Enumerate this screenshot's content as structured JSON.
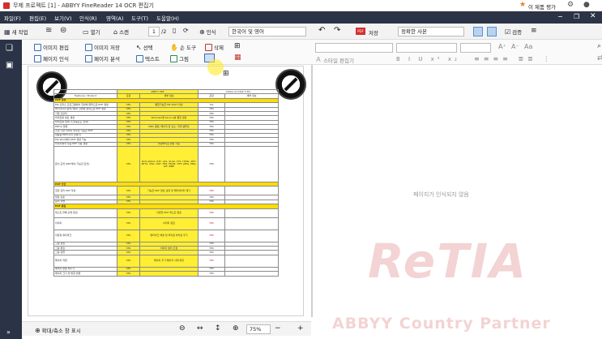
{
  "title": {
    "text": "무제 프로젝트 [1] - ABBYY FineReader 14 OCR 편집기",
    "rating": "이 제품 평가"
  },
  "menu": [
    "파일(F)",
    "편집(E)",
    "보기(V)",
    "인식(R)",
    "영역(A)",
    "도구(T)",
    "도움말(H)"
  ],
  "toolbar": {
    "new_task": "새 작업",
    "open": "열기",
    "scan": "스캔",
    "page_num": "1",
    "page_total": "/2",
    "recognize": "인식",
    "language": "한국어 및 영어",
    "save": "저장",
    "save_mode": "정확한 사본",
    "check": "검증"
  },
  "ribbon": {
    "image_edit": "이미지 편집",
    "image_save": "이미지 저장",
    "page_recog": "페이지 인식",
    "page_analyze": "페이지 분석",
    "select": "선택",
    "hand_tool": "손 도구",
    "delete": "삭제",
    "text": "텍스트",
    "picture": "그림",
    "style_editor": "스타일 편집기"
  },
  "doc": {
    "side_label": "[ [FS] 출력마마 편집 기능 비교 (FS) ]",
    "col_header": "Features / Product",
    "abbyy": "ABBYY PDF",
    "adobe": "Adobe Acrobat X Pro",
    "sub": [
      "포함",
      "세부 정보",
      "포함",
      "세부 정보"
    ],
    "rows": [
      [
        "sec",
        "PDF 생성",
        "",
        "",
        ""
      ],
      [
        "r",
        "MS 오피스 프로그램에서 한번에 클릭으로 PDF 생성",
        "YES",
        "통합가능한 MS 2007 이상",
        "Yes"
      ],
      [
        "r",
        "Windows 탐색기에서 한번에 클릭으로 PDF 생성",
        "YES",
        "",
        "YES"
      ],
      [
        "r",
        "기업 프린터",
        "YES",
        "",
        "YES"
      ],
      [
        "r",
        "바이트를 필요 생성",
        "YES",
        "Windows에 Service를 통한 생성",
        "YES"
      ],
      [
        "r",
        "바이트를 현재 기간(중요도 전략)",
        "YES",
        "",
        "YES"
      ],
      [
        "r",
        "PDF/A 압축",
        "YES",
        "MRC 종편, 페이지 정 감소, 기대 템플릿",
        "YES"
      ],
      [
        "r",
        "스캔 기반 이미지 최우선 가능한 PDF",
        "YES",
        "",
        "YES"
      ],
      [
        "r",
        "대용량 PDF(자서 인쇄기)",
        "YES",
        "",
        "YES"
      ],
      [
        "r",
        "MS Word에서 PDF 생성 가능",
        "YES",
        "",
        "YES"
      ],
      [
        "r",
        "이미지에서 다중 PDF 자동 생성",
        "YES",
        "불량처리로 변환 가능",
        "YES"
      ],
      [
        "t",
        "문서 포맷 (PDF에서 가능한 포맷)",
        "YES",
        "DOC,DOCX, RTF, XLS, XLSX, TXT, HTML, PPT, PPTX, XML, ODT, FB2, EPUB, TIFF, JPEG, PNG, GIF, BMP",
        "YES"
      ],
      [
        "sec",
        "PDF 보안",
        "",
        "",
        ""
      ],
      [
        "r2",
        "권한 관리 PDF 작성",
        "YES",
        "가능한 PDF 암호 설정 및 메타데이터 제거",
        "YES"
      ],
      [
        "r",
        "암호 보호",
        "YES",
        "",
        "YES"
      ],
      [
        "r",
        "문서 서명",
        "YES",
        "",
        "YES"
      ],
      [
        "sec",
        "PDF 편집",
        "",
        "",
        ""
      ],
      [
        "r2",
        "텍스트 블록 단위 편집",
        "YES",
        "다양한 PDF 텍스트 편집",
        "YES"
      ],
      [
        "r3",
        "이미지",
        "YES",
        "이미지 편집",
        "YES"
      ],
      [
        "r3",
        "자유형 워터마크",
        "YES",
        "워터마크 배경 및 머리글 바닥글 추가",
        "YES"
      ],
      [
        "r",
        "그림 삽입",
        "YES",
        "",
        "YES"
      ],
      [
        "r",
        "그림 편집",
        "YES",
        "이미지 필터 조정",
        "YES"
      ],
      [
        "r",
        "그림 정렬",
        "YES",
        "",
        "YES"
      ],
      [
        "r3",
        "페이지 작업",
        "YES",
        "페이지 추가 페이지 삭제 회전",
        "YES"
      ],
      [
        "r",
        "페이지 번호 매기기",
        "YES",
        "",
        "YES"
      ],
      [
        "r",
        "페이지 크기 및 방향 변경",
        "YES",
        "",
        "YES"
      ]
    ],
    "red_row_val": "YES"
  },
  "textpane": {
    "empty": "페이지가 인식되지 않음"
  },
  "status": {
    "zoom_label": "확대/축소 창 표시",
    "zoom": "75%"
  },
  "watermark": {
    "logo": "ReTIA",
    "partner": "ABBYY Country Partner"
  }
}
